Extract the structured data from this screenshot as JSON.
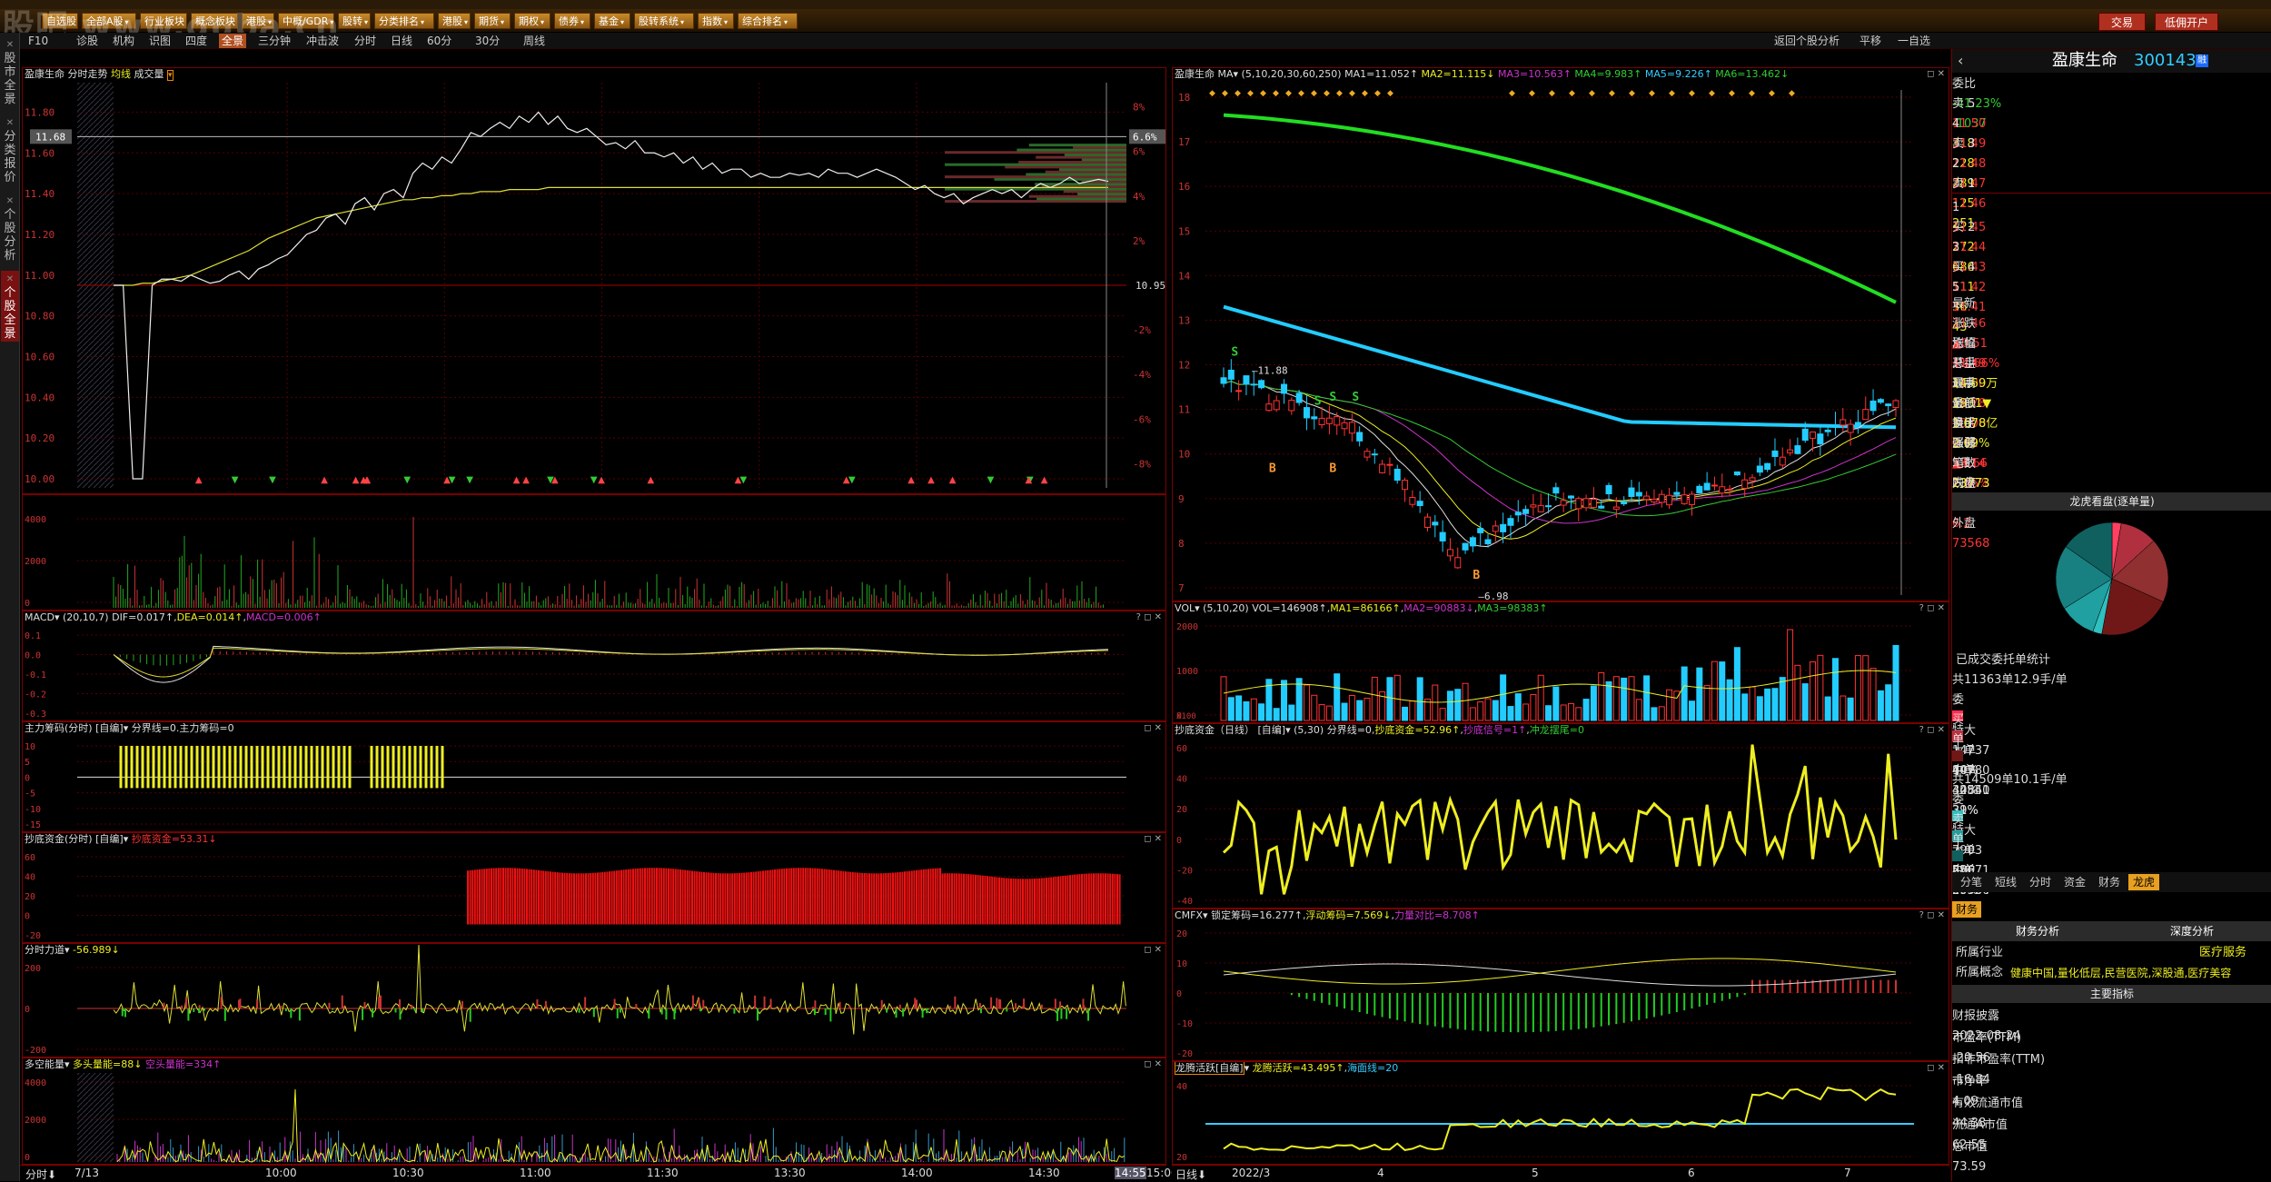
{
  "watermark": "股吧 www.guba.cn",
  "menu": {
    "items": [
      "自选股",
      "全部A股",
      "行业板块",
      "概念板块",
      "港股",
      "中概/GDR",
      "股转",
      "分类排名",
      "港股",
      "期货",
      "期权",
      "债券",
      "基金",
      "股转系统",
      "指数",
      "综合排名"
    ],
    "right": [
      "交易",
      "低佣开户"
    ]
  },
  "leftnav": [
    {
      "label": "股市全景",
      "active": false
    },
    {
      "label": "分类报价",
      "active": false
    },
    {
      "label": "个股分析",
      "active": false
    },
    {
      "label": "个股全景",
      "active": true
    }
  ],
  "subbar": {
    "left": [
      "F10",
      "诊股",
      "机构",
      "识图",
      "四度",
      "全景",
      "三分钟",
      "冲击波",
      "分时",
      "日线",
      "60分",
      "30分",
      "周线"
    ],
    "active": "全景",
    "right": [
      "返回个股分析",
      "平移",
      "一自选"
    ]
  },
  "intraday": {
    "title": "盈康生命",
    "mode": "分时走势",
    "mode2": "均线",
    "mode3": "成交量",
    "price_ticks": [
      "11.80",
      "11.60",
      "11.40",
      "11.20",
      "11.00",
      "10.80",
      "10.60",
      "10.40",
      "10.20",
      "10.00"
    ],
    "pct_ticks": [
      "8%",
      "6%",
      "4%",
      "2%",
      "",
      "-2%",
      "-4%",
      "-6%",
      "-8%"
    ],
    "current_price": "11.68",
    "current_pct": "6.6%",
    "prev_close": "10.95",
    "price": [
      10.95,
      10.95,
      10.0,
      10.0,
      10.95,
      10.98,
      10.98,
      10.97,
      11.0,
      10.98,
      10.96,
      10.97,
      11.0,
      11.02,
      10.98,
      11.03,
      11.05,
      11.08,
      11.1,
      11.15,
      11.2,
      11.22,
      11.28,
      11.3,
      11.25,
      11.35,
      11.38,
      11.32,
      11.4,
      11.42,
      11.38,
      11.5,
      11.55,
      11.52,
      11.58,
      11.55,
      11.62,
      11.7,
      11.68,
      11.72,
      11.75,
      11.72,
      11.78,
      11.75,
      11.8,
      11.74,
      11.78,
      11.72,
      11.7,
      11.72,
      11.68,
      11.64,
      11.65,
      11.62,
      11.66,
      11.6,
      11.6,
      11.58,
      11.6,
      11.55,
      11.58,
      11.52,
      11.55,
      11.5,
      11.52,
      11.52,
      11.48,
      11.5,
      11.48,
      11.48,
      11.5,
      11.49,
      11.5,
      11.48,
      11.52,
      11.5,
      11.5,
      11.48,
      11.5,
      11.52,
      11.5,
      11.48,
      11.45,
      11.42,
      11.44,
      11.4,
      11.38,
      11.4,
      11.35,
      11.38,
      11.4,
      11.42,
      11.4,
      11.42,
      11.38,
      11.42,
      11.45,
      11.43,
      11.45,
      11.48,
      11.45,
      11.46,
      11.47,
      11.46
    ],
    "avg": [
      10.95,
      10.95,
      10.95,
      10.96,
      10.96,
      10.97,
      10.98,
      10.99,
      11.0,
      11.02,
      11.04,
      11.06,
      11.08,
      11.1,
      11.12,
      11.15,
      11.18,
      11.2,
      11.22,
      11.24,
      11.26,
      11.28,
      11.29,
      11.3,
      11.31,
      11.32,
      11.33,
      11.34,
      11.35,
      11.36,
      11.37,
      11.37,
      11.38,
      11.38,
      11.39,
      11.39,
      11.4,
      11.4,
      11.41,
      11.41,
      11.41,
      11.42,
      11.42,
      11.42,
      11.42,
      11.43,
      11.43,
      11.43,
      11.43,
      11.43,
      11.43,
      11.43,
      11.43,
      11.43,
      11.43,
      11.43,
      11.43,
      11.43,
      11.43,
      11.43,
      11.43,
      11.43,
      11.43,
      11.43,
      11.43,
      11.43,
      11.43,
      11.43,
      11.43,
      11.43,
      11.43,
      11.43,
      11.43,
      11.43,
      11.43,
      11.43,
      11.43,
      11.43,
      11.43,
      11.43,
      11.43,
      11.43,
      11.43,
      11.43,
      11.43,
      11.43,
      11.43,
      11.43,
      11.43,
      11.43,
      11.43,
      11.43,
      11.43,
      11.43,
      11.43,
      11.43,
      11.43,
      11.43,
      11.43,
      11.43,
      11.43,
      11.43,
      11.43,
      11.43
    ],
    "vol_ticks": [
      "4000",
      "2000",
      "0"
    ],
    "x_ticks": [
      "7/13",
      "10:00",
      "10:30",
      "11:00",
      "11:30",
      "13:30",
      "14:00",
      "14:30",
      "14:55",
      "15:00"
    ],
    "bottom_left": "分时"
  },
  "macd": {
    "label": "MACD",
    "params": "(20,10,7)",
    "dif": "DIF=0.017↑",
    "dea": "DEA=0.014↑",
    "macd": "MACD=0.006↑",
    "ticks": [
      "0.1",
      "0.0",
      "-0.1",
      "-0.2",
      "-0.3"
    ]
  },
  "zlcm": {
    "label": "主力筹码(分时)",
    "self": "[自编]",
    "line": "分界线=0.主力筹码=0",
    "ticks": [
      "10",
      "5",
      "0",
      "-5",
      "-10",
      "-15"
    ]
  },
  "cdzj": {
    "label": "抄底资金(分时)",
    "self": "[自编]",
    "val": "抄底资金=53.31↓",
    "ticks": [
      "60",
      "40",
      "20",
      "0",
      "-20"
    ]
  },
  "fsld": {
    "label": "分时力道",
    "val": "-56.989↓",
    "ticks": [
      "200",
      "0",
      "-200"
    ]
  },
  "dkl": {
    "label": "多空能量",
    "a": "多头量能=88↓",
    "b": "空头量能=334↑",
    "ticks": [
      "4000",
      "2000",
      "0"
    ]
  },
  "daily": {
    "title": "盈康生命",
    "ma_label": "MA",
    "ma_params": "(5,10,20,30,60,250)",
    "ma": [
      "MA1=11.052↑",
      "MA2=11.115↓",
      "MA3=10.563↑",
      "MA4=9.983↑",
      "MA5=9.226↑",
      "MA6=13.462↓"
    ],
    "ma_colors": [
      "#ddd",
      "#ee2",
      "#c3c",
      "#3c3",
      "#3cf",
      "#3c3"
    ],
    "ticks": [
      "18",
      "17",
      "16",
      "15",
      "14",
      "13",
      "12",
      "11",
      "10",
      "9",
      "8",
      "7"
    ],
    "high_label": "11.88",
    "low_label": "6.98",
    "x_ticks": [
      "2022/3",
      "4",
      "5",
      "6",
      "7"
    ],
    "bottom_left": "日线"
  },
  "vol": {
    "label": "VOL",
    "params": "(5,10,20)",
    "v": "VOL=146908↑",
    "ma1": "MA1=86166↑",
    "ma2": "MA2=90883↓",
    "ma3": "MA3=98383↑",
    "ticks": [
      "2000",
      "1000",
      "0"
    ],
    "unit": "X100"
  },
  "cdzj2": {
    "label": "抄底资金（日线）",
    "self": "[自编]",
    "params": "(5,30)",
    "a": "分界线=0",
    "b": "抄底资金=52.96↑",
    "c": "抄底信号=1↑",
    "d": "冲龙摆尾=0",
    "ticks": [
      "60",
      "40",
      "20",
      "0",
      "-20",
      "-40"
    ]
  },
  "cmfx": {
    "label": "CMFX",
    "a": "锁定筹码=16.277↑",
    "b": "浮动筹码=7.569↓",
    "c": "力量对比=8.708↑",
    "ticks": [
      "20",
      "10",
      "0",
      "-10",
      "-20"
    ]
  },
  "lths": {
    "label": "龙腾活跃[自编]",
    "a": "龙腾活跃=43.495↑",
    "b": "海面线=20",
    "ticks": [
      "40",
      "20"
    ]
  },
  "quote": {
    "name": "盈康生命",
    "code": "300143",
    "weibi_label": "委比",
    "weibi": "-41.23%",
    "weicha": "-1037",
    "asks": [
      [
        "卖",
        "5",
        "11.50",
        "318"
      ],
      [
        "卖",
        "4",
        "11.49",
        "228"
      ],
      [
        "卖",
        "3",
        "11.48",
        "289"
      ],
      [
        "卖",
        "2",
        "11.47",
        "125"
      ],
      [
        "卖",
        "1",
        "11.46",
        "251"
      ]
    ],
    "bids": [
      [
        "买",
        "1",
        "11.45",
        "272"
      ],
      [
        "买",
        "2",
        "11.44",
        "686"
      ],
      [
        "买",
        "3",
        "11.43",
        "511"
      ],
      [
        "买",
        "4",
        "11.42",
        "36"
      ],
      [
        "买",
        "5",
        "11.41",
        "43"
      ]
    ],
    "stats": [
      [
        "最新",
        "11.46",
        "均价",
        "11.49"
      ],
      [
        "涨跌",
        "▲0.51",
        "开盘",
        "11.00"
      ],
      [
        "涨幅",
        "+4.66%",
        "最高",
        "11.78"
      ],
      [
        "总手",
        "14.69万",
        "最低",
        "10.00"
      ],
      [
        "现手",
        "1931▼",
        "量比",
        "0.92"
      ],
      [
        "金额",
        "1.678亿",
        "强弱",
        "▲4.66"
      ],
      [
        "换手",
        "2.69%",
        "5日",
        "7.86%"
      ],
      [
        "涨停",
        "13.14",
        "跌停",
        "8.76"
      ],
      [
        "笔数",
        "23773",
        "均笔",
        "6.2"
      ],
      [
        "内盘",
        "73340",
        "外盘",
        "73568"
      ]
    ],
    "pie_title": "龙虎看盘(逐单量)",
    "pie": [
      {
        "v": 5,
        "c": "#ff4060"
      },
      {
        "v": 20,
        "c": "#b03040"
      },
      {
        "v": 35,
        "c": "#903030"
      },
      {
        "v": 40,
        "c": "#701818"
      },
      {
        "v": 5,
        "c": "#30c0c0"
      },
      {
        "v": 20,
        "c": "#20a0a0"
      },
      {
        "v": 35,
        "c": "#188080"
      },
      {
        "v": 29,
        "c": "#106060"
      }
    ],
    "order_title": "已成交委托单统计",
    "sell_header": "共11363单12.9手/单",
    "sell": [
      [
        "委",
        "特大",
        "14737",
        "10%",
        "#ff3050"
      ],
      [
        "买",
        "大单",
        "44780",
        "30%",
        "#c03040"
      ],
      [
        "单",
        "中单",
        "44840",
        "31%",
        "#903030"
      ],
      [
        "",
        "小单",
        "42551",
        "29%",
        "#701818"
      ]
    ],
    "buy_header": "共14509单10.1手/单",
    "buy": [
      [
        "委",
        "特大",
        "7903",
        "5%",
        "#30c0c0"
      ],
      [
        "卖",
        "大单",
        "28671",
        "20%",
        "#20a0a0"
      ],
      [
        "单",
        "中单",
        "50984",
        "35%",
        "#188080"
      ],
      [
        "",
        "小单",
        "59350",
        "40%",
        "#106060"
      ]
    ],
    "tabs": [
      "分笔",
      "短线",
      "分时",
      "资金",
      "财务",
      "龙虎"
    ],
    "tab_active": "龙虎",
    "fin_tab": "财务",
    "fin_sub": [
      "财务分析",
      "深度分析"
    ],
    "industry_label": "所属行业",
    "industry": "医疗服务",
    "concept_label": "所属概念",
    "concept": "健康中国,量化低层,民营医院,深股通,医疗美容",
    "main_idx": "主要指标",
    "fin": [
      [
        "财报披露",
        "2022-08-24"
      ],
      [
        "市盈率(TTM)",
        "-20.56"
      ],
      [
        "扣非市盈率(TTM)",
        "-16.84"
      ],
      [
        "市净率",
        "4.09"
      ],
      [
        "有效流通市值",
        "44.38"
      ],
      [
        "流通A市值",
        "62.55"
      ],
      [
        "总市值",
        "73.59"
      ]
    ]
  }
}
